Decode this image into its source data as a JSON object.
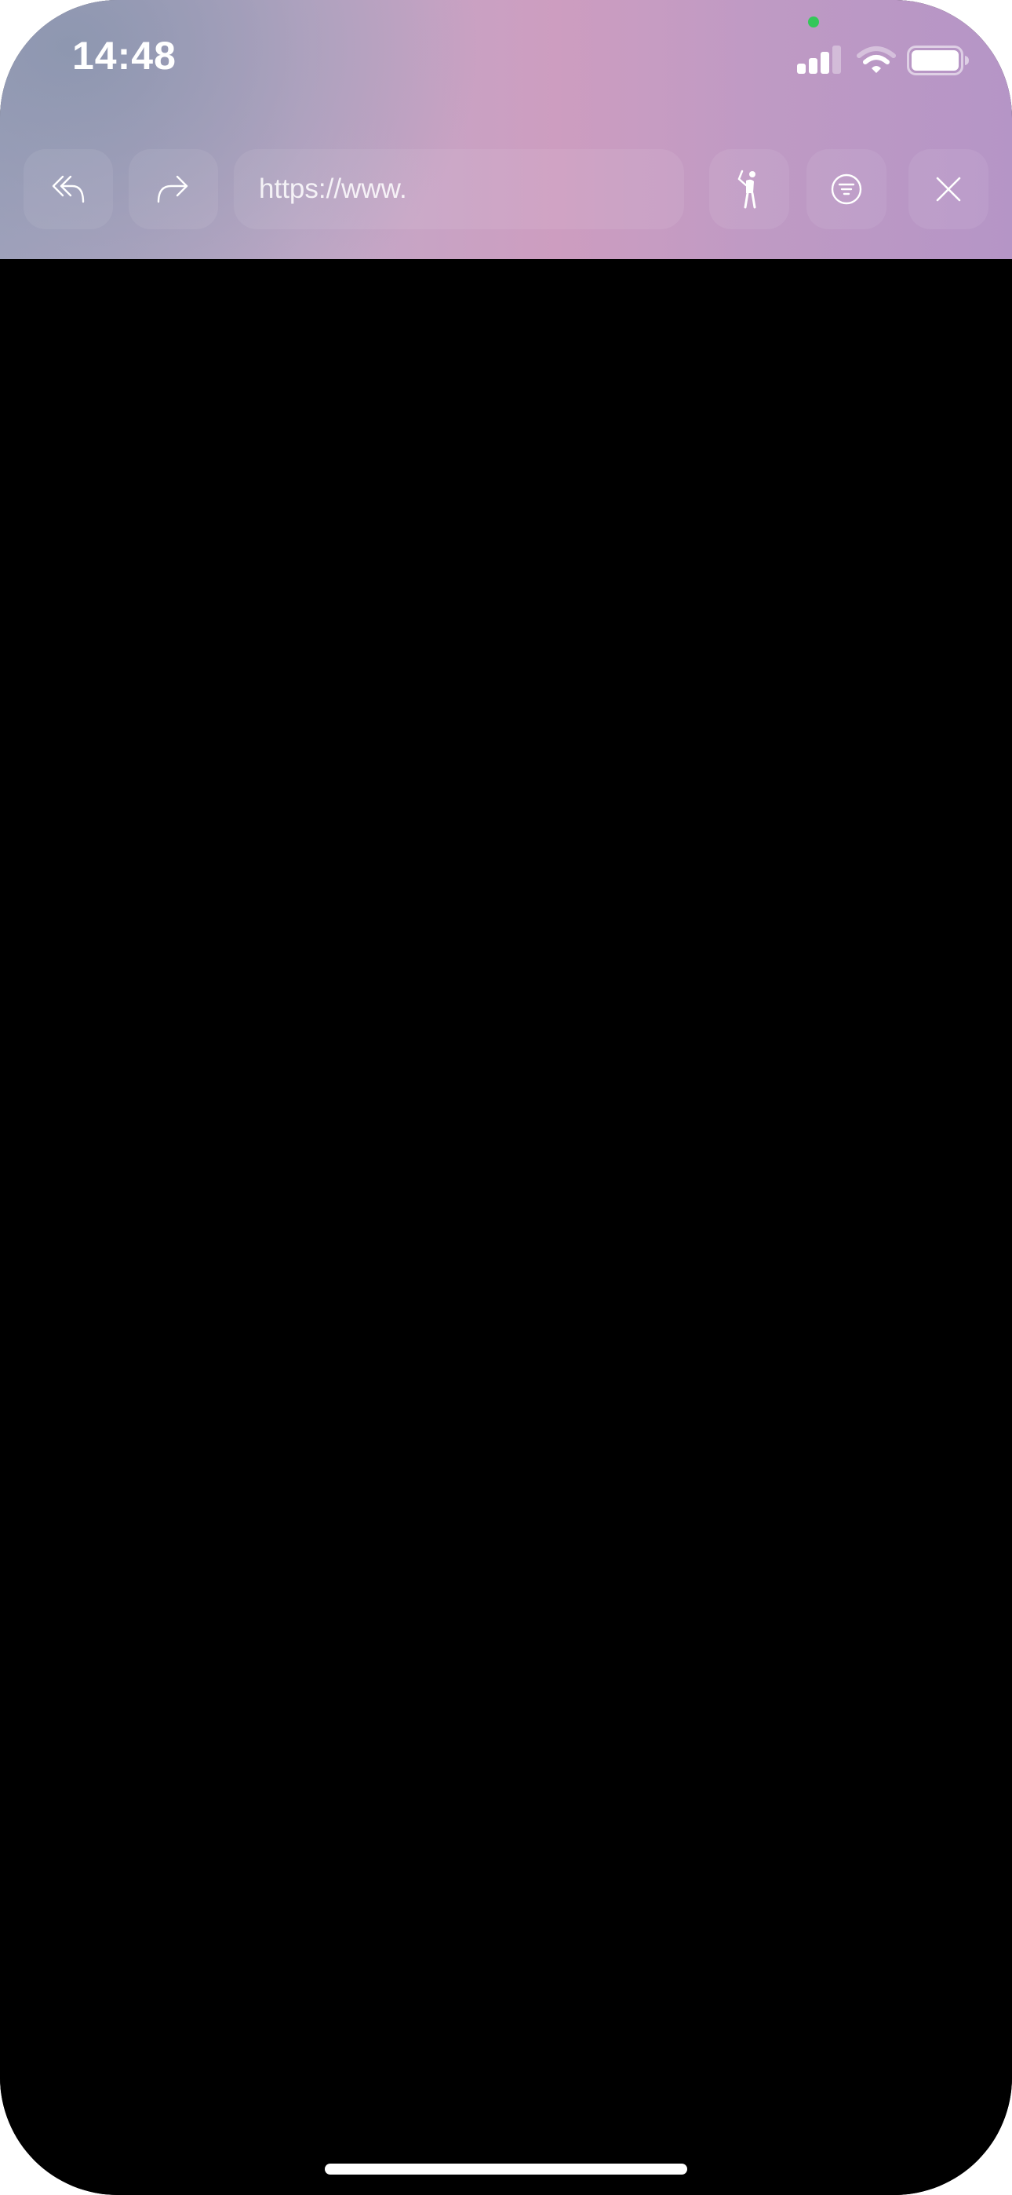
{
  "status_bar": {
    "time": "14:48",
    "signal_icon": "cellular-signal-icon",
    "wifi_icon": "wifi-icon",
    "battery_icon": "battery-icon",
    "camera_indicator_color": "#34c759"
  },
  "browser_toolbar": {
    "back_icon": "reply-arrow-icon",
    "forward_icon": "forward-arrow-icon",
    "url": "https://www.",
    "character_icon": "walking-figure-icon",
    "filter_icon": "filter-menu-icon",
    "close_icon": "close-icon",
    "header_gradient": [
      "#a7a6c0",
      "#c3a9c8",
      "#cd9dc0",
      "#bf9ac4",
      "#b595c6"
    ]
  },
  "page": {
    "background_color": "#000000"
  }
}
